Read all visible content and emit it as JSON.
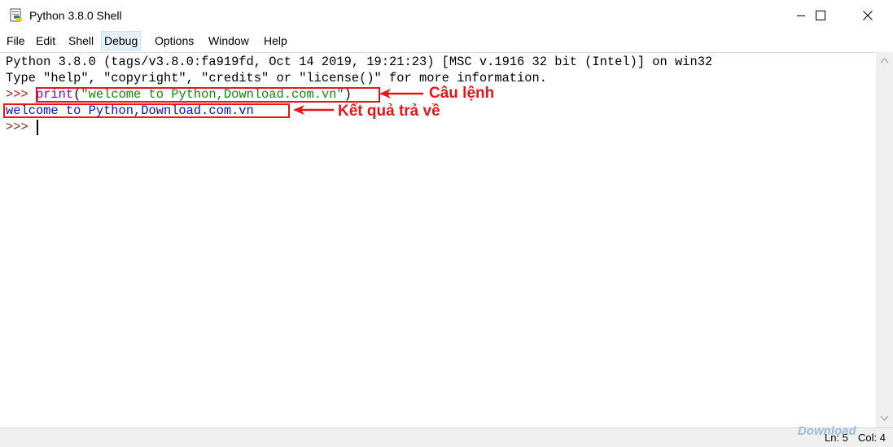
{
  "window": {
    "title": "Python 3.8.0 Shell"
  },
  "menu": {
    "items": [
      "File",
      "Edit",
      "Shell",
      "Debug",
      "Options",
      "Window",
      "Help"
    ],
    "active": "Debug"
  },
  "shell": {
    "banner_line1": "Python 3.8.0 (tags/v3.8.0:fa919fd, Oct 14 2019, 19:21:23) [MSC v.1916 32 bit (Intel)] on win32",
    "banner_line2": "Type \"help\", \"copyright\", \"credits\" or \"license()\" for more information.",
    "prompt": ">>> ",
    "cmd_func": "print",
    "cmd_open": "(",
    "cmd_string": "\"welcome to Python,Download.com.vn\"",
    "cmd_close": ")",
    "output": "welcome to Python,Download.com.vn",
    "prompt2": ">>> "
  },
  "annotations": {
    "command": "Câu lệnh",
    "result": "Kết quả trả về"
  },
  "status": {
    "line": "Ln: 5",
    "col": "Col: 4"
  },
  "watermark": "Download",
  "colors": {
    "annotation": "#e8151b",
    "output": "#1010d0",
    "string": "#108a10",
    "builtin": "#9000a0",
    "prompt": "#8a2d1c"
  },
  "icons": {
    "app": "python-idle-icon",
    "minimize": "minimize-icon",
    "maximize": "maximize-icon",
    "close": "close-icon"
  }
}
